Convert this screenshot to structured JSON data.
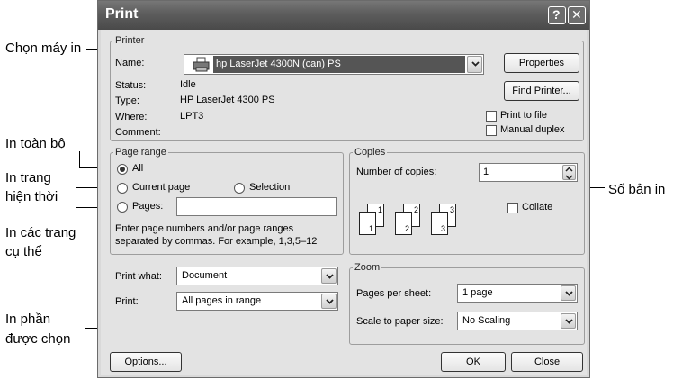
{
  "callouts": {
    "printer_select": "Chọn máy in",
    "print_all": "In toàn bộ",
    "current_page_1": "In trang",
    "current_page_2": "hiện thời",
    "pages_1": "In các trang",
    "pages_2": "cụ thể",
    "selection_1": "In phần",
    "selection_2": "được chọn",
    "copies": "Số bản in"
  },
  "dialog": {
    "title": "Print",
    "help_glyph": "?",
    "close_glyph": "✕",
    "printer": {
      "legend": "Printer",
      "name_label": "Name:",
      "name_value": "hp LaserJet 4300N (can) PS",
      "status_label": "Status:",
      "status_value": "Idle",
      "type_label": "Type:",
      "type_value": "HP LaserJet 4300 PS",
      "where_label": "Where:",
      "where_value": "LPT3",
      "comment_label": "Comment:",
      "properties_label": "Properties",
      "find_printer_label": "Find Printer...",
      "print_to_file_label": "Print to file",
      "manual_duplex_label": "Manual duplex"
    },
    "page_range": {
      "legend": "Page range",
      "all_label": "All",
      "current_page_label": "Current page",
      "selection_label": "Selection",
      "pages_label": "Pages:",
      "pages_value": "",
      "hint_line1": "Enter page numbers and/or page ranges",
      "hint_line2": "separated by commas.  For example, 1,3,5–12",
      "selected": "All"
    },
    "copies": {
      "legend": "Copies",
      "number_label": "Number of copies:",
      "number_value": "1",
      "collate_label": "Collate",
      "collate_checked": false,
      "page_icons": [
        {
          "front": "1",
          "back": "1"
        },
        {
          "front": "2",
          "back": "2"
        },
        {
          "front": "3",
          "back": "3"
        }
      ]
    },
    "print_what": {
      "label": "Print what:",
      "value": "Document"
    },
    "print": {
      "label": "Print:",
      "value": "All pages in range"
    },
    "zoom": {
      "legend": "Zoom",
      "pages_per_sheet_label": "Pages per sheet:",
      "pages_per_sheet_value": "1 page",
      "scale_label": "Scale to paper size:",
      "scale_value": "No Scaling"
    },
    "options_label": "Options...",
    "ok_label": "OK",
    "close_label": "Close"
  }
}
